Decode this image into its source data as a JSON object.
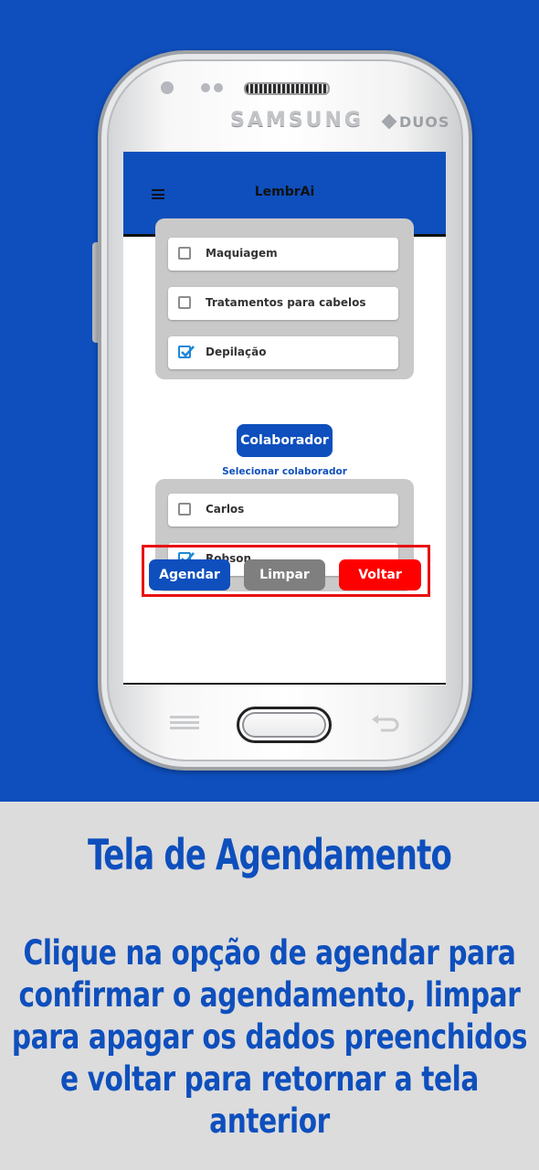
{
  "app": {
    "title": "LembrAi",
    "menu_icon": "hamburger-menu-icon"
  },
  "device": {
    "brand": "SAMSUNG",
    "model_badge": "DUOS"
  },
  "services": [
    {
      "label": "Maquiagem",
      "checked": false
    },
    {
      "label": "Tratamentos para cabelos",
      "checked": false
    },
    {
      "label": "Depilação",
      "checked": true
    }
  ],
  "collaborator": {
    "button_label": "Colaborador",
    "hint": "Selecionar colaborador",
    "options": [
      {
        "label": "Carlos",
        "checked": false
      },
      {
        "label": "Robson",
        "checked": true
      }
    ]
  },
  "actions": {
    "schedule_label": "Agendar",
    "clear_label": "Limpar",
    "back_label": "Voltar"
  },
  "caption": {
    "title": "Tela de Agendamento",
    "body": "Clique na opção de agendar para confirmar o agendamento, limpar para apagar os dados preenchidos e voltar para retornar a tela anterior"
  },
  "colors": {
    "brand_blue": "#0e4fbd",
    "clear_gray": "#7f7f7f",
    "back_red": "#ff0000",
    "highlight_red": "#e81010",
    "checkbox_blue": "#1e88d8"
  }
}
